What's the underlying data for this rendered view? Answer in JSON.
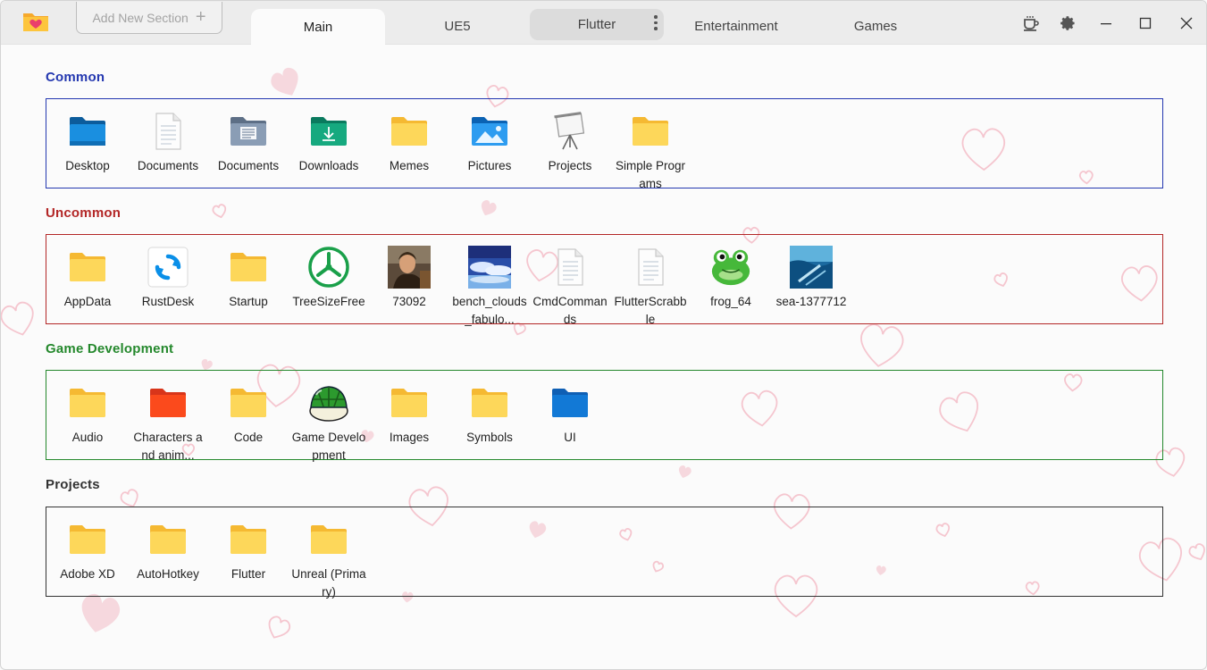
{
  "tabs": {
    "add_section": "Add New Section",
    "items": [
      {
        "label": "Main"
      },
      {
        "label": "UE5"
      },
      {
        "label": "Flutter"
      },
      {
        "label": "Entertainment"
      },
      {
        "label": "Games"
      }
    ],
    "active": "Main"
  },
  "window_controls": [
    "coffee-icon",
    "settings-gear-icon",
    "minimize-icon",
    "maximize-icon",
    "close-icon"
  ],
  "colors": {
    "common": "#2438b0",
    "uncommon": "#b32727",
    "game_dev": "#24882c",
    "projects": "#333333",
    "folder": "#fcd144",
    "hearts": "#f3bcc7"
  },
  "sections": [
    {
      "title": "Common",
      "items": [
        {
          "label": "Desktop",
          "icon": "desktop-folder-icon"
        },
        {
          "label": "Documents",
          "icon": "document-icon"
        },
        {
          "label": "Documents",
          "icon": "documents-folder-icon"
        },
        {
          "label": "Downloads",
          "icon": "downloads-folder-icon"
        },
        {
          "label": "Memes",
          "icon": "folder-icon"
        },
        {
          "label": "Pictures",
          "icon": "pictures-folder-icon"
        },
        {
          "label": "Projects",
          "icon": "projector-icon"
        },
        {
          "label": "Simple Programs",
          "icon": "folder-icon"
        }
      ]
    },
    {
      "title": "Uncommon",
      "items": [
        {
          "label": "AppData",
          "icon": "folder-icon"
        },
        {
          "label": "RustDesk",
          "icon": "rustdesk-icon"
        },
        {
          "label": "Startup",
          "icon": "folder-icon"
        },
        {
          "label": "TreeSizeFree",
          "icon": "treesize-icon"
        },
        {
          "label": "73092",
          "icon": "photo-thumbnail-icon"
        },
        {
          "label": "bench_clouds_fabulo...",
          "icon": "clouds-thumbnail-icon"
        },
        {
          "label": "CmdCommands",
          "icon": "document-icon"
        },
        {
          "label": "FlutterScrabble",
          "icon": "document-icon"
        },
        {
          "label": "frog_64",
          "icon": "frog-icon"
        },
        {
          "label": "sea-1377712",
          "icon": "sea-thumbnail-icon"
        }
      ]
    },
    {
      "title": "Game Development",
      "items": [
        {
          "label": "Audio",
          "icon": "folder-icon"
        },
        {
          "label": "Characters and anim...",
          "icon": "red-folder-icon"
        },
        {
          "label": "Code",
          "icon": "folder-icon"
        },
        {
          "label": "Game Development",
          "icon": "green-shell-icon"
        },
        {
          "label": "Images",
          "icon": "folder-icon"
        },
        {
          "label": "Symbols",
          "icon": "folder-icon"
        },
        {
          "label": "UI",
          "icon": "blue-folder-icon"
        }
      ]
    },
    {
      "title": "Projects",
      "items": [
        {
          "label": "Adobe XD",
          "icon": "folder-icon"
        },
        {
          "label": "AutoHotkey",
          "icon": "folder-icon"
        },
        {
          "label": "Flutter",
          "icon": "folder-icon"
        },
        {
          "label": "Unreal (Primary)",
          "icon": "folder-icon"
        }
      ]
    }
  ]
}
